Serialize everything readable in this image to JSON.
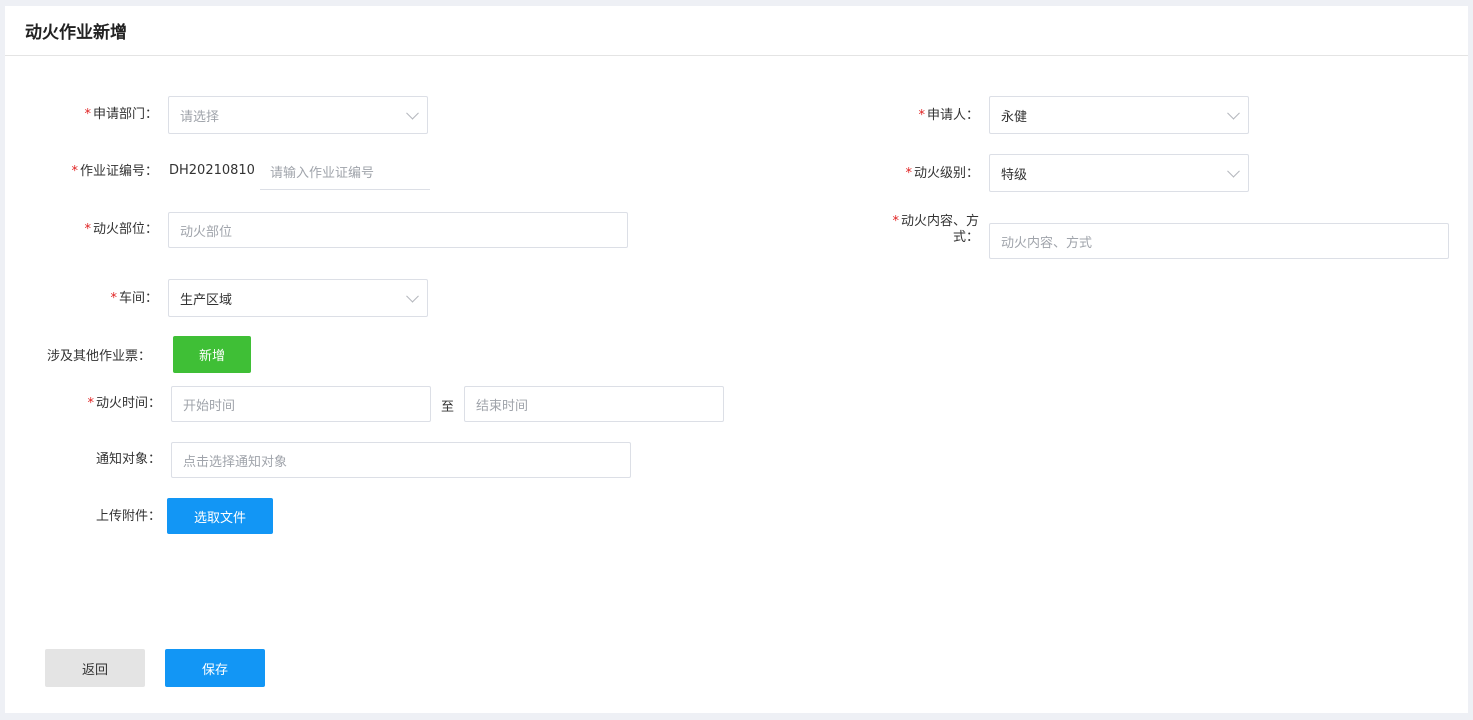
{
  "page": {
    "title": "动火作业新增"
  },
  "form": {
    "dept": {
      "label": "申请部门：",
      "placeholder": "请选择"
    },
    "applicant": {
      "label": "申请人：",
      "value": "永健"
    },
    "cert": {
      "label": "作业证编号：",
      "prefix": "DH20210810",
      "placeholder": "请输入作业证编号"
    },
    "level": {
      "label": "动火级别：",
      "value": "特级"
    },
    "location": {
      "label": "动火部位：",
      "placeholder": "动火部位"
    },
    "content": {
      "label_line1": "动火内容、方",
      "label_line2": "式：",
      "placeholder": "动火内容、方式"
    },
    "workshop": {
      "label": "车间：",
      "value": "生产区域"
    },
    "other_tickets": {
      "label": "涉及其他作业票：",
      "button": "新增"
    },
    "time": {
      "label": "动火时间：",
      "start_placeholder": "开始时间",
      "separator": "至",
      "end_placeholder": "结束时间"
    },
    "notify": {
      "label": "通知对象：",
      "placeholder": "点击选择通知对象"
    },
    "attachment": {
      "label": "上传附件：",
      "button": "选取文件"
    }
  },
  "actions": {
    "back": "返回",
    "save": "保存"
  },
  "required_mark": "*",
  "colors": {
    "primary": "#1296f5",
    "success": "#3fbf36",
    "required": "#e02020",
    "secondary": "#e4e4e4"
  }
}
